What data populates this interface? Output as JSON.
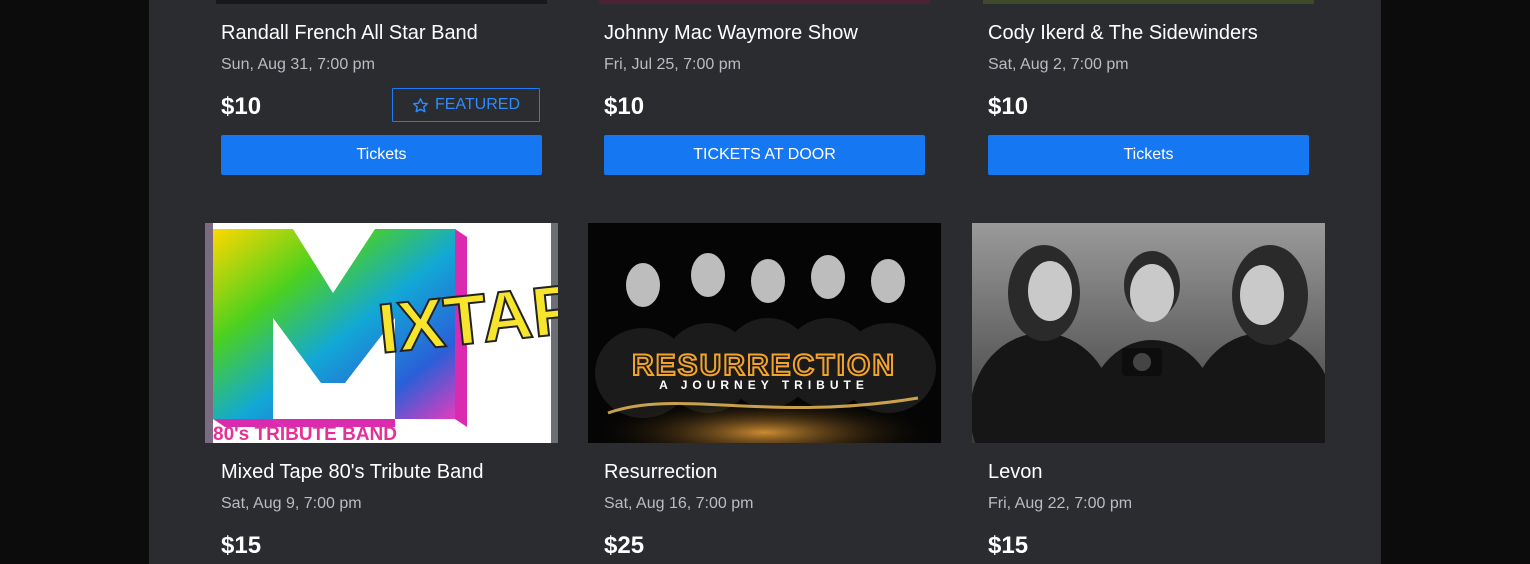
{
  "top_row": [
    {
      "title": "Randall French All Star Band",
      "date": "Sun, Aug 31, 7:00 pm",
      "price": "$10",
      "badge": "FEATURED",
      "button": "Tickets"
    },
    {
      "title": "Johnny Mac Waymore Show",
      "date": "Fri, Jul 25, 7:00 pm",
      "price": "$10",
      "button": "TICKETS AT DOOR"
    },
    {
      "title": "Cody Ikerd & The Sidewinders",
      "date": "Sat, Aug 2, 7:00 pm",
      "price": "$10",
      "button": "Tickets"
    }
  ],
  "bottom_row": [
    {
      "title": "Mixed Tape 80's Tribute Band",
      "date": "Sat, Aug 9, 7:00 pm",
      "price": "$15",
      "poster": {
        "logo_big": "M",
        "logo_rest": "IXTAPE",
        "caption": "80's TRIBUTE BAND"
      }
    },
    {
      "title": "Resurrection",
      "date": "Sat, Aug 16, 7:00 pm",
      "price": "$25",
      "poster": {
        "logo": "RESURRECTION",
        "subtitle": "A JOURNEY TRIBUTE"
      }
    },
    {
      "title": "Levon",
      "date": "Fri, Aug 22, 7:00 pm",
      "price": "$15"
    }
  ],
  "icons": {
    "featured": "star-outline-icon"
  },
  "colors": {
    "page_bg": "#0c0c0d",
    "panel_bg": "#2a2c30",
    "accent": "#1677f2",
    "text": "#ffffff",
    "muted": "#b9bcc1"
  }
}
